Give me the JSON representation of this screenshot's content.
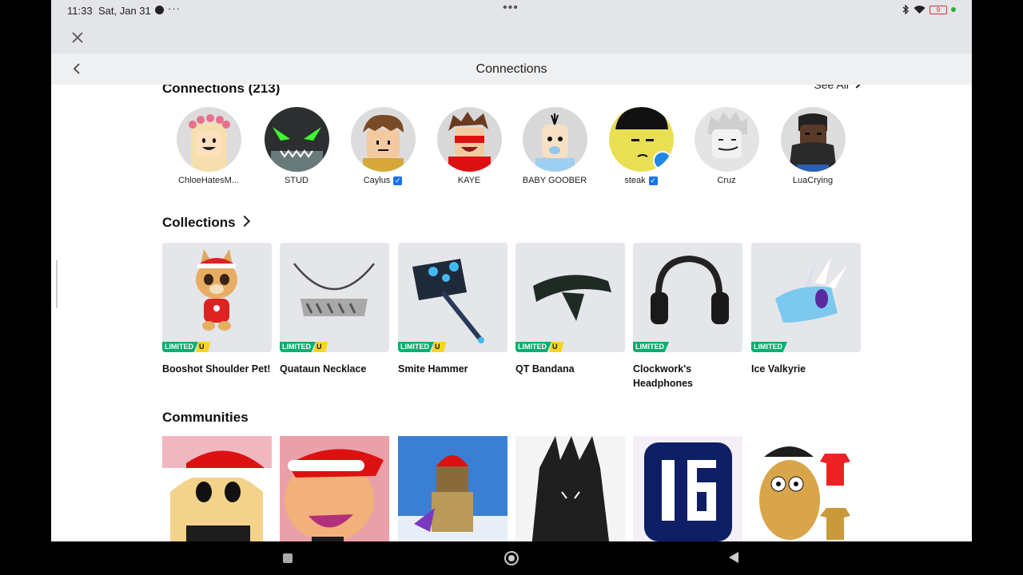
{
  "status": {
    "time": "11:33",
    "date": "Sat, Jan 31",
    "more": "···",
    "center_dots": "•••",
    "battery": "9"
  },
  "nav": {
    "title": "Connections"
  },
  "connections": {
    "title": "Connections (213)",
    "see_all": "See All",
    "friends": [
      {
        "name": "ChloeHatesM...",
        "verified": false
      },
      {
        "name": "STUD",
        "verified": false
      },
      {
        "name": "Caylus",
        "verified": true
      },
      {
        "name": "KAYE",
        "verified": false
      },
      {
        "name": "BABY GOOBER",
        "verified": false
      },
      {
        "name": "steak",
        "verified": true
      },
      {
        "name": "Cruz",
        "verified": false
      },
      {
        "name": "LuaCrying",
        "verified": false
      }
    ]
  },
  "collections": {
    "title": "Collections",
    "items": [
      {
        "name": "Booshot Shoulder Pet!",
        "limited": "LIMITED",
        "u": "U"
      },
      {
        "name": "Quataun Necklace",
        "limited": "LIMITED",
        "u": "U"
      },
      {
        "name": "Smite Hammer",
        "limited": "LIMITED",
        "u": "U"
      },
      {
        "name": "QT Bandana",
        "limited": "LIMITED",
        "u": "U"
      },
      {
        "name": "Clockwork's Headphones",
        "limited": "LIMITED",
        "u": ""
      },
      {
        "name": "Ice Valkyrie",
        "limited": "LIMITED",
        "u": ""
      }
    ]
  },
  "communities": {
    "title": "Communities"
  },
  "verified_mark": "✓",
  "colors": {
    "accent_green": "#00b06f",
    "accent_yellow": "#f7d51d",
    "verified_blue": "#1a73e8"
  }
}
